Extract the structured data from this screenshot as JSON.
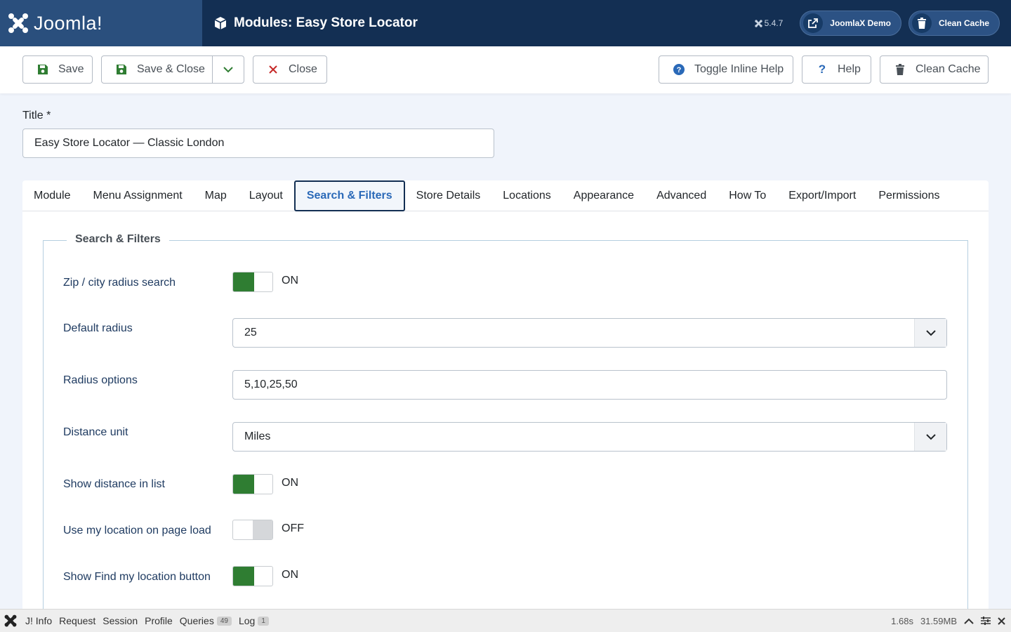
{
  "header": {
    "logo_text": "Joomla!",
    "page_title": "Modules: Easy Store Locator",
    "version": "5.4.7",
    "demo_button": "JoomlaX Demo",
    "cache_button": "Clean Cache"
  },
  "toolbar": {
    "save": "Save",
    "save_close": "Save & Close",
    "close": "Close",
    "toggle_help": "Toggle Inline Help",
    "help": "Help",
    "clean_cache": "Clean Cache"
  },
  "form": {
    "title_label": "Title *",
    "title_value": "Easy Store Locator — Classic London"
  },
  "tabs": [
    {
      "label": "Module"
    },
    {
      "label": "Menu Assignment"
    },
    {
      "label": "Map"
    },
    {
      "label": "Layout"
    },
    {
      "label": "Search & Filters"
    },
    {
      "label": "Store Details"
    },
    {
      "label": "Locations"
    },
    {
      "label": "Appearance"
    },
    {
      "label": "Advanced"
    },
    {
      "label": "How To"
    },
    {
      "label": "Export/Import"
    },
    {
      "label": "Permissions"
    }
  ],
  "active_tab": "Search & Filters",
  "fieldset": {
    "legend": "Search & Filters",
    "zip_radius": {
      "label": "Zip / city radius search",
      "state": "ON"
    },
    "default_radius": {
      "label": "Default radius",
      "value": "25"
    },
    "radius_options": {
      "label": "Radius options",
      "value": "5,10,25,50"
    },
    "distance_unit": {
      "label": "Distance unit",
      "value": "Miles"
    },
    "show_distance": {
      "label": "Show distance in list",
      "state": "ON"
    },
    "use_location": {
      "label": "Use my location on page load",
      "state": "OFF"
    },
    "find_location": {
      "label": "Show Find my location button",
      "state": "ON"
    }
  },
  "debug": {
    "info": "J! Info",
    "request": "Request",
    "session": "Session",
    "profile": "Profile",
    "queries": "Queries",
    "queries_count": "49",
    "log": "Log",
    "log_count": "1",
    "time": "1.68s",
    "memory": "31.59MB"
  },
  "colors": {
    "header_bg": "#132f53",
    "logo_bg": "#2a4f7d",
    "switch_on": "#2f7d32",
    "active_tab_text": "#2a69b8"
  }
}
